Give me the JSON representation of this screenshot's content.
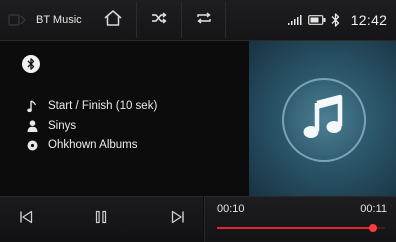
{
  "topbar": {
    "source_icon": "bluetooth-music-icon",
    "source_label": "BT Music",
    "home_icon": "home-icon",
    "shuffle_icon": "shuffle-icon",
    "repeat_icon": "repeat-icon",
    "signal_icon": "signal-strength-icon",
    "battery_icon": "battery-icon",
    "bluetooth_icon": "bluetooth-icon",
    "clock": "12:42"
  },
  "track": {
    "title": "Start / Finish (10 sek)",
    "artist": "Sinys",
    "album": "Ohkhown Albums",
    "title_icon": "music-note-icon",
    "artist_icon": "person-icon",
    "album_icon": "disc-icon",
    "device_icon": "bluetooth-icon"
  },
  "album_art": {
    "icon": "music-note-icon",
    "bg": "#2a5468"
  },
  "controls": {
    "prev_icon": "skip-previous-icon",
    "pause_icon": "pause-icon",
    "next_icon": "skip-next-icon"
  },
  "progress": {
    "elapsed": "00:10",
    "total": "00:11",
    "fraction": 0.93,
    "accent": "#e0262e"
  }
}
